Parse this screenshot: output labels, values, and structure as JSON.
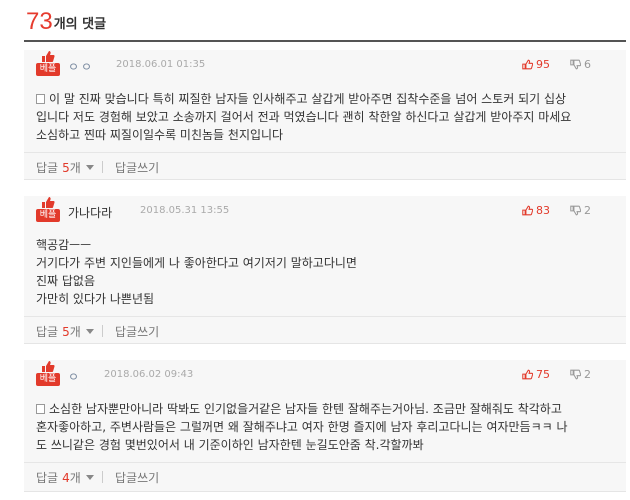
{
  "header": {
    "count": "73",
    "label": "개의 댓글"
  },
  "comments": [
    {
      "badge_label": "베플",
      "author": "ㅇㅇ",
      "date": "2018.06.01 01:35",
      "upvotes": "95",
      "downvotes": "6",
      "lines": [
        "이 말 진짜 맞습니다 특히 찌질한 남자들 인사해주고 살갑게 받아주면 집착수준을 넘어 스토커 되기 십상",
        "입니다 저도 경험해 보았고 소송까지 걸어서 전과 먹였습니다 괜히 착한알 하신다고 살갑게 받아주지 마세요",
        "소심하고 찐따 찌질이일수록 미친놈들 천지입니다"
      ],
      "reply_label": "답글",
      "reply_count": "5",
      "reply_unit": "개",
      "write_label": "답글쓰기"
    },
    {
      "badge_label": "베플",
      "author": "가나다라",
      "date": "2018.05.31 13:55",
      "upvotes": "83",
      "downvotes": "2",
      "lines": [
        "핵공감ㅡㅡ",
        "거기다가 주변 지인들에게 나 좋아한다고 여기저기 말하고다니면",
        "진짜 답없음",
        "가만히 있다가 나쁜년됨"
      ],
      "reply_label": "답글",
      "reply_count": "5",
      "reply_unit": "개",
      "write_label": "답글쓰기"
    },
    {
      "badge_label": "베플",
      "author": "ㅇ",
      "date": "2018.06.02 09:43",
      "upvotes": "75",
      "downvotes": "2",
      "lines": [
        "소심한 남자뿐만아니라 딱봐도 인기없을거같은 남자들 한텐 잘해주는거아님. 조금만 잘해줘도 착각하고",
        "혼자좋아하고, 주변사람들은 그럴꺼면 왜 잘해주냐고 여자 한명 즐지에 남자 후리고다니는 여자만듬ㅋㅋ 나",
        "도 쓰니같은 경험 몇번있어서 내 기준이하인 남자한텐 눈길도안줌 착.각할까봐"
      ],
      "reply_label": "답글",
      "reply_count": "4",
      "reply_unit": "개",
      "write_label": "답글쓰기"
    }
  ]
}
